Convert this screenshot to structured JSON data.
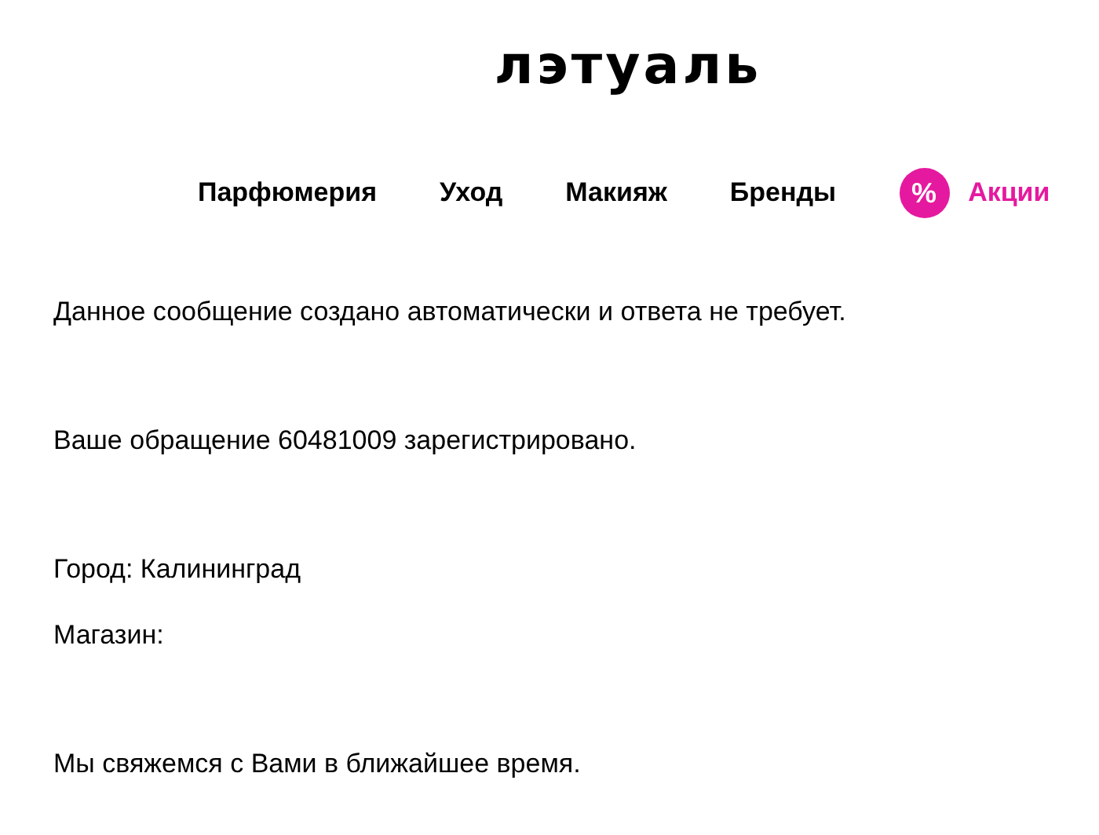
{
  "logo": "лэтуаль",
  "nav": [
    {
      "label": "Парфюмерия",
      "kind": "link"
    },
    {
      "label": "Уход",
      "kind": "link"
    },
    {
      "label": "Макияж",
      "kind": "link"
    },
    {
      "label": "Бренды",
      "kind": "link"
    },
    {
      "label": "Акции",
      "kind": "sale",
      "badge": "%",
      "color": "#e5199f"
    }
  ],
  "message_blocks": [
    [
      "Данное сообщение создано автоматически и ответа не требует."
    ],
    [
      "Ваше обращение 60481009 зарегистрировано."
    ],
    [
      "Город: Калининград",
      "Магазин:"
    ],
    [
      "Мы свяжемся с Вами в ближайшее время."
    ]
  ]
}
